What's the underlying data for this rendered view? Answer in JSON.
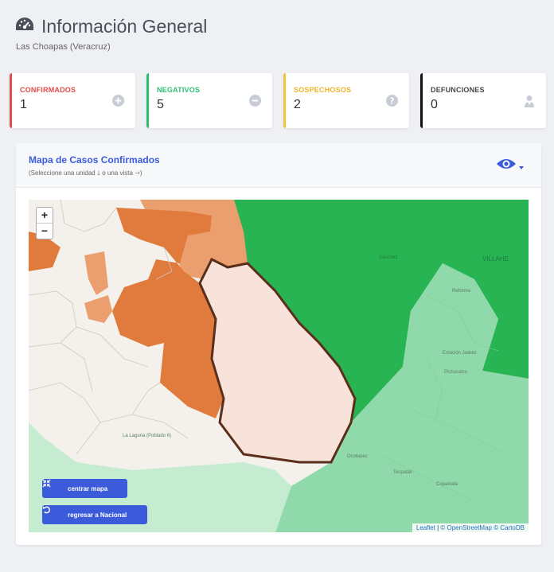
{
  "header": {
    "icon": "dashboard-icon",
    "title": "Información General",
    "subtitle": "Las Choapas (Veracruz)"
  },
  "cards": [
    {
      "label": "CONFIRMADOS",
      "value": "1",
      "icon": "plus-circle-icon",
      "color": "#e14b4b"
    },
    {
      "label": "NEGATIVOS",
      "value": "5",
      "icon": "minus-circle-icon",
      "color": "#2dbf71"
    },
    {
      "label": "SOSPECHOSOS",
      "value": "2",
      "icon": "question-circle-icon",
      "color": "#f4c430"
    },
    {
      "label": "DEFUNCIONES",
      "value": "0",
      "icon": "user-icon",
      "color": "#111111"
    }
  ],
  "map_panel": {
    "title": "Mapa de Casos Confirmados",
    "subtitle": "(Seleccione una unidad 🡓 o una vista 🡒)",
    "eye_icon": "eye-icon",
    "zoom_in": "+",
    "zoom_out": "−",
    "buttons": {
      "center": "centrar mapa",
      "back": "regresar a Nacional"
    },
    "attribution": {
      "leaflet": "Leaflet",
      "osm": "© OpenStreetMap",
      "carto": "© CartoDB"
    },
    "labels": {
      "la_laguna": "La Laguna (Poblado 6)",
      "sanchez": "Sánchez",
      "villahe": "VILLAHE",
      "estacion": "Estación Juárez",
      "pichucalco": "Pichucalco",
      "reforma": "Reforma",
      "ocotepec": "Ocotepec",
      "copainala": "Copainalá",
      "tecpatan": "Tecpatán"
    },
    "colors": {
      "dark_green": "#28b453",
      "light_green": "#90d9aa",
      "pale_green": "#c5ecd1",
      "orange": "#e07a3d",
      "light_orange": "#ec9f6e",
      "selected_fill": "#f7e3d9",
      "selected_border": "#5a2e1a"
    }
  }
}
